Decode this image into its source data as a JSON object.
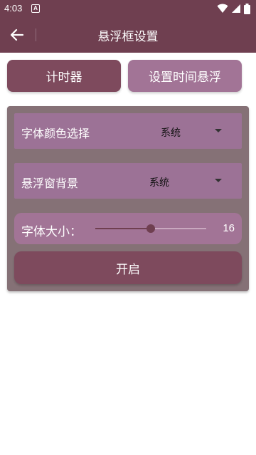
{
  "status_bar": {
    "time": "4:03",
    "notification_icon": "a-notification-icon",
    "icons": [
      "wifi-icon",
      "signal-icon",
      "battery-icon"
    ]
  },
  "app_bar": {
    "title": "悬浮框设置",
    "back_icon": "arrow-left-icon"
  },
  "tabs": [
    {
      "label": "计时器"
    },
    {
      "label": "设置时间悬浮"
    }
  ],
  "settings": {
    "font_color": {
      "label": "字体颜色选择",
      "value": "系统"
    },
    "window_background": {
      "label": "悬浮窗背景",
      "value": "系统"
    },
    "font_size": {
      "label": "字体大小：",
      "value": "16",
      "fraction": 0.5
    },
    "start_button": "开启"
  },
  "colors": {
    "primary": "#6f3f50",
    "button": "#7e4a5d",
    "accent": "#a27496",
    "panel": "#857176",
    "row": "#9c7296"
  }
}
